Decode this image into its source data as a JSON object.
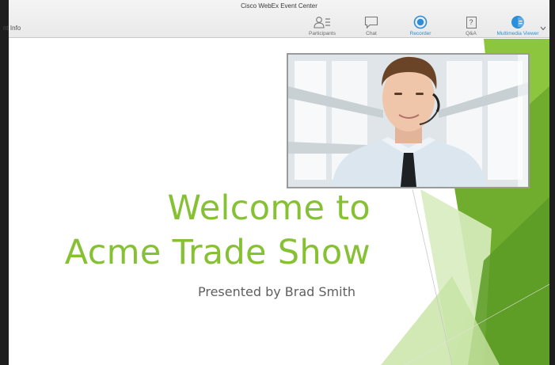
{
  "window": {
    "title": "Cisco WebEx Event Center"
  },
  "toolbar": {
    "left_label": "nt Info",
    "items": [
      {
        "label": "Participants",
        "icon": "participants-icon"
      },
      {
        "label": "Chat",
        "icon": "chat-icon"
      },
      {
        "label": "Recorder",
        "icon": "recorder-icon"
      },
      {
        "label": "Q&A",
        "icon": "qa-icon"
      },
      {
        "label": "Multimedia Viewer",
        "icon": "multimedia-viewer-icon"
      }
    ],
    "qa_glyph": "?",
    "active_color": "#2a8fd8"
  },
  "slide": {
    "title_line1": "Welcome to",
    "title_line2": "Acme Trade Show",
    "subtitle": "Presented by Brad Smith",
    "accent_color": "#86c133"
  },
  "video": {
    "subject": "presenter-with-headset"
  }
}
